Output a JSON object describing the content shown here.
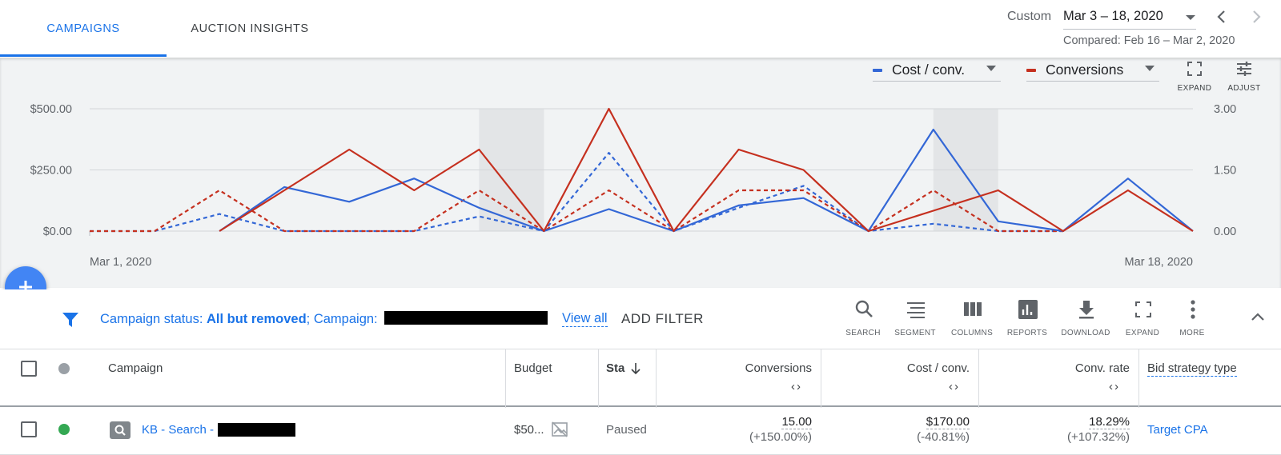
{
  "tabs": [
    {
      "label": "CAMPAIGNS",
      "active": true
    },
    {
      "label": "AUCTION INSIGHTS",
      "active": false
    }
  ],
  "date": {
    "custom_label": "Custom",
    "range": "Mar 3 – 18, 2020",
    "compared": "Compared: Feb 16 – Mar 2, 2020"
  },
  "chart_controls": {
    "metric1": {
      "label": "Cost / conv.",
      "color": "#3367d6"
    },
    "metric2": {
      "label": "Conversions",
      "color": "#c5301f"
    },
    "expand_label": "EXPAND",
    "adjust_label": "ADJUST"
  },
  "chart_data": {
    "type": "line",
    "x_start_label": "Mar 1, 2020",
    "x_end_label": "Mar 18, 2020",
    "left_axis": {
      "ticks": [
        "$500.00",
        "$250.00",
        "$0.00"
      ],
      "ylim": [
        0,
        500
      ]
    },
    "right_axis": {
      "ticks": [
        "3.00",
        "1.50",
        "0.00"
      ],
      "ylim": [
        0,
        3
      ]
    },
    "grid": true,
    "weekend_shading": [
      [
        7,
        8
      ],
      [
        14,
        15
      ]
    ],
    "series": [
      {
        "name": "Cost / conv.",
        "axis": "left",
        "style": "solid",
        "color": "#3367d6",
        "x": [
          3,
          4,
          5,
          6,
          7,
          8,
          9,
          10,
          11,
          12,
          13,
          14,
          15,
          16,
          17,
          18
        ],
        "values": [
          0,
          180,
          120,
          215,
          95,
          0,
          90,
          0,
          105,
          135,
          0,
          415,
          40,
          0,
          215,
          0
        ]
      },
      {
        "name": "Cost / conv. (previous)",
        "axis": "left",
        "style": "dashed",
        "color": "#3367d6",
        "x": [
          1,
          2,
          3,
          4,
          5,
          6,
          7,
          8,
          9,
          10,
          11,
          12,
          13,
          14,
          15,
          16,
          17,
          18
        ],
        "values": [
          0,
          0,
          70,
          0,
          0,
          0,
          60,
          0,
          320,
          0,
          95,
          185,
          0,
          30,
          0,
          0,
          null,
          null
        ]
      },
      {
        "name": "Conversions",
        "axis": "right",
        "style": "solid",
        "color": "#c5301f",
        "x": [
          3,
          4,
          5,
          6,
          7,
          8,
          9,
          10,
          11,
          12,
          13,
          14,
          15,
          16,
          17,
          18
        ],
        "values": [
          0,
          1,
          2,
          1,
          2,
          0,
          3,
          0,
          2,
          1.5,
          0,
          0.5,
          1,
          0,
          1,
          0
        ]
      },
      {
        "name": "Conversions (previous)",
        "axis": "right",
        "style": "dashed",
        "color": "#c5301f",
        "x": [
          1,
          2,
          3,
          4,
          5,
          6,
          7,
          8,
          9,
          10,
          11,
          12,
          13,
          14,
          15,
          16
        ],
        "values": [
          0,
          0,
          1,
          0,
          0,
          0,
          1,
          0,
          1,
          0,
          1,
          1,
          0,
          1,
          0,
          0
        ]
      }
    ]
  },
  "filter": {
    "status_prefix": "Campaign status: ",
    "status_value": "All but removed",
    "campaign_prefix": ";  Campaign: ",
    "view_all": "View all",
    "add_filter": "ADD FILTER"
  },
  "toolbar": [
    {
      "icon": "search-icon",
      "label": "SEARCH"
    },
    {
      "icon": "segment-icon",
      "label": "SEGMENT"
    },
    {
      "icon": "columns-icon",
      "label": "COLUMNS"
    },
    {
      "icon": "reports-icon",
      "label": "REPORTS"
    },
    {
      "icon": "download-icon",
      "label": "DOWNLOAD"
    },
    {
      "icon": "expand-icon",
      "label": "EXPAND"
    },
    {
      "icon": "more-icon",
      "label": "MORE"
    }
  ],
  "table": {
    "headers": {
      "campaign": "Campaign",
      "budget": "Budget",
      "status": "Sta",
      "conversions": "Conversions",
      "cost_conv": "Cost / conv.",
      "conv_rate": "Conv. rate",
      "bid_strategy": "Bid strategy type"
    },
    "rows": [
      {
        "status_color": "#34a853",
        "campaign": "KB - Search - ",
        "budget": "$50...",
        "status": "Paused",
        "conversions": "15.00",
        "conversions_change": "(+150.00%)",
        "cost_conv": "$170.00",
        "cost_conv_change": "(-40.81%)",
        "conv_rate": "18.29%",
        "conv_rate_change": "(+107.32%)",
        "bid_strategy": "Target CPA"
      }
    ]
  }
}
